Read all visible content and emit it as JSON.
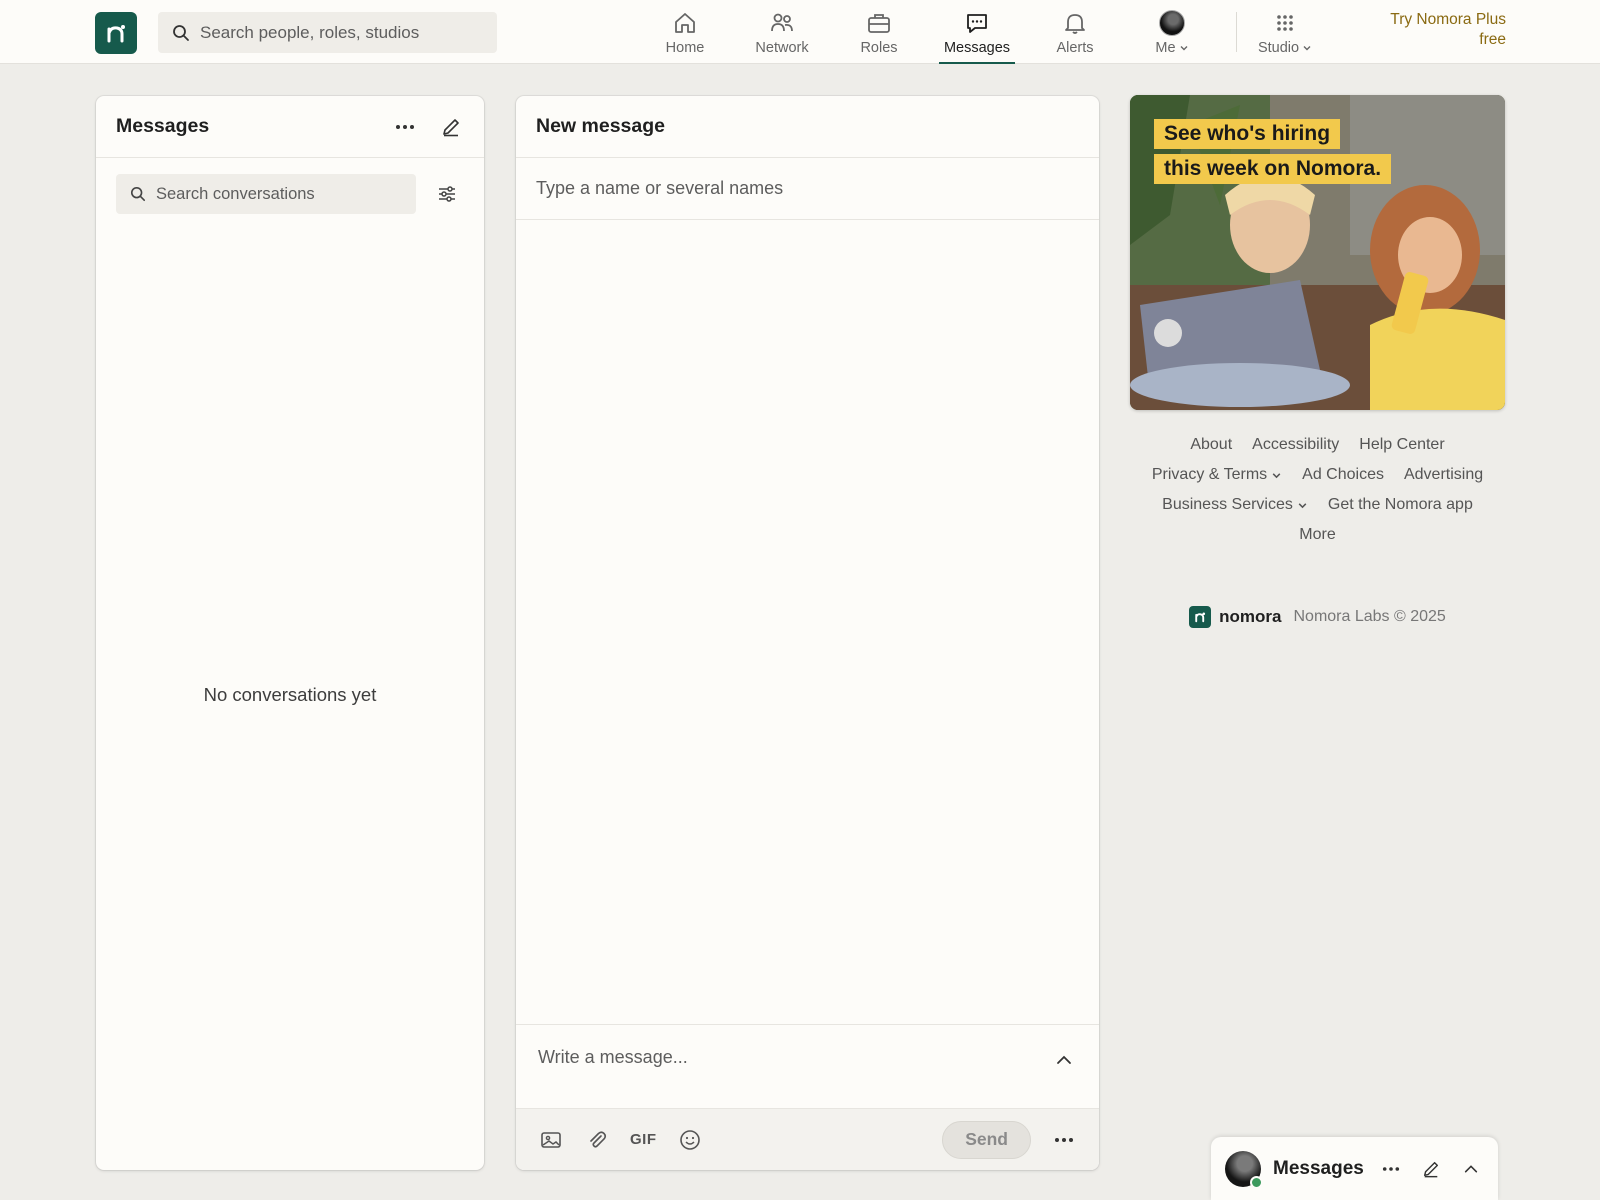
{
  "nav": {
    "logo_glyph": "n",
    "search_placeholder": "Search people, roles, studios",
    "items": [
      {
        "label": "Home",
        "icon": "home-icon"
      },
      {
        "label": "Network",
        "icon": "people-icon"
      },
      {
        "label": "Roles",
        "icon": "briefcase-icon"
      },
      {
        "label": "Messages",
        "icon": "chat-icon",
        "active": true
      },
      {
        "label": "Alerts",
        "icon": "bell-icon"
      },
      {
        "label": "Me",
        "icon": "avatar"
      },
      {
        "label": "Studio",
        "icon": "grid-icon"
      }
    ],
    "try_plus_line1": "Try Nomora Plus",
    "try_plus_line2": "free"
  },
  "left": {
    "title": "Messages",
    "search_placeholder": "Search conversations",
    "empty": "No conversations yet"
  },
  "compose": {
    "title": "New message",
    "to_placeholder": "Type a name or several names",
    "body_placeholder": "Write a message...",
    "gif_label": "GIF",
    "send_label": "Send"
  },
  "ad": {
    "line1": "See who's hiring",
    "line2": "this week on Nomora."
  },
  "footer": {
    "row1": [
      "About",
      "Accessibility",
      "Help Center"
    ],
    "row2": [
      "Privacy & Terms",
      "Ad Choices",
      "Advertising"
    ],
    "row3": [
      "Business Services",
      "Get the Nomora app"
    ],
    "row4": [
      "More"
    ],
    "brand": "nomora",
    "copyright": "Nomora Labs © 2025"
  },
  "msg_bar": {
    "title": "Messages"
  },
  "colors": {
    "brand": "#165a4c",
    "accent_gold": "#8a6a12",
    "ad_highlight": "#f2c94c",
    "online": "#3d9a5e"
  }
}
